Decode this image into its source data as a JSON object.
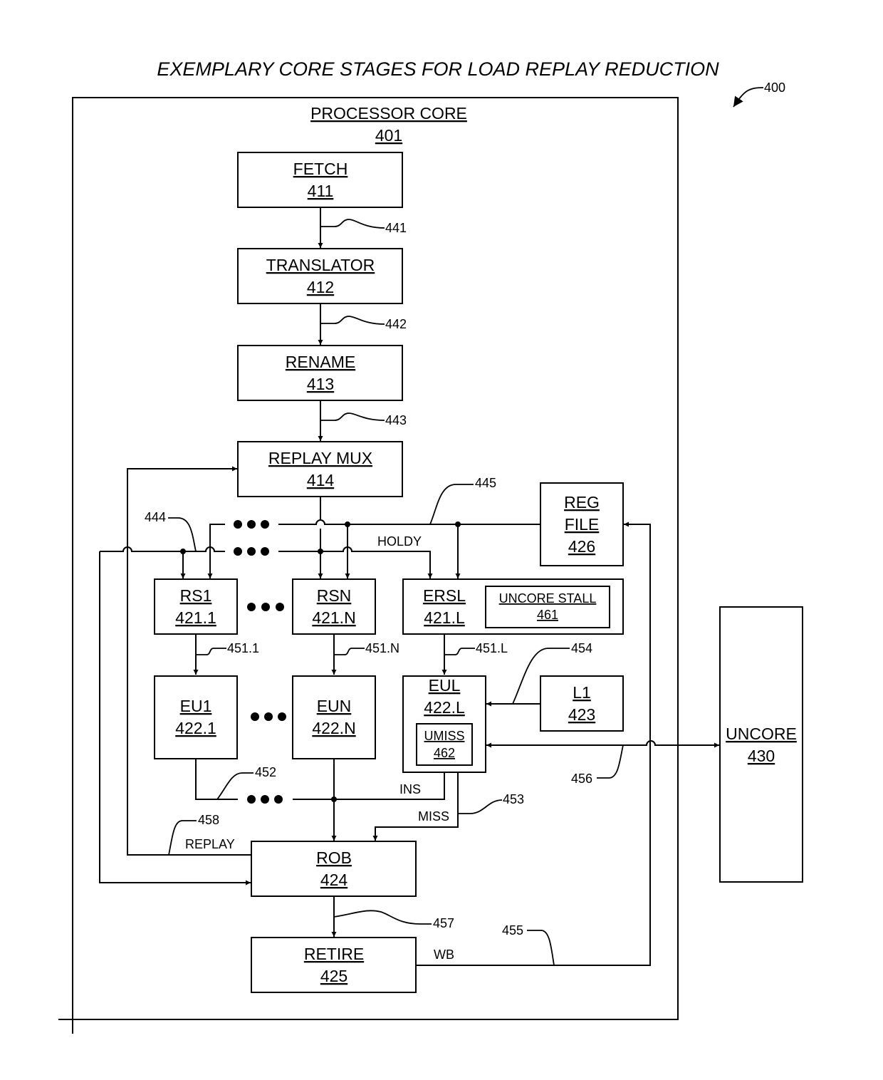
{
  "figure": {
    "title": "EXEMPLARY CORE STAGES FOR LOAD REPLAY REDUCTION",
    "figure_ref": "400"
  },
  "core": {
    "name": "PROCESSOR CORE",
    "ref": "401"
  },
  "blocks": {
    "fetch": {
      "name": "FETCH",
      "ref": "411"
    },
    "translator": {
      "name": "TRANSLATOR",
      "ref": "412"
    },
    "rename": {
      "name": "RENAME",
      "ref": "413"
    },
    "replay_mux": {
      "name": "REPLAY MUX",
      "ref": "414"
    },
    "reg_file": {
      "line1": "REG",
      "line2": "FILE",
      "ref": "426"
    },
    "rs1": {
      "name": "RS1",
      "ref": "421.1"
    },
    "rsn": {
      "name": "RSN",
      "ref": "421.N"
    },
    "ersl": {
      "name": "ERSL",
      "ref": "421.L"
    },
    "uncore_stall": {
      "name": "UNCORE STALL",
      "ref": "461"
    },
    "eu1": {
      "name": "EU1",
      "ref": "422.1"
    },
    "eun": {
      "name": "EUN",
      "ref": "422.N"
    },
    "eul": {
      "name": "EUL",
      "ref": "422.L"
    },
    "umiss": {
      "name": "UMISS",
      "ref": "462"
    },
    "l1": {
      "name": "L1",
      "ref": "423"
    },
    "rob": {
      "name": "ROB",
      "ref": "424"
    },
    "retire": {
      "name": "RETIRE",
      "ref": "425"
    },
    "uncore": {
      "name": "UNCORE",
      "ref": "430"
    }
  },
  "refs": {
    "r441": "441",
    "r442": "442",
    "r443": "443",
    "r444": "444",
    "r445": "445",
    "r451_1": "451.1",
    "r451_n": "451.N",
    "r451_l": "451.L",
    "r452": "452",
    "r453": "453",
    "r454": "454",
    "r455": "455",
    "r456": "456",
    "r457": "457",
    "r458": "458"
  },
  "signals": {
    "holdy": "HOLDY",
    "ins": "INS",
    "miss": "MISS",
    "replay": "REPLAY",
    "wb": "WB"
  },
  "ellipsis": "•••"
}
